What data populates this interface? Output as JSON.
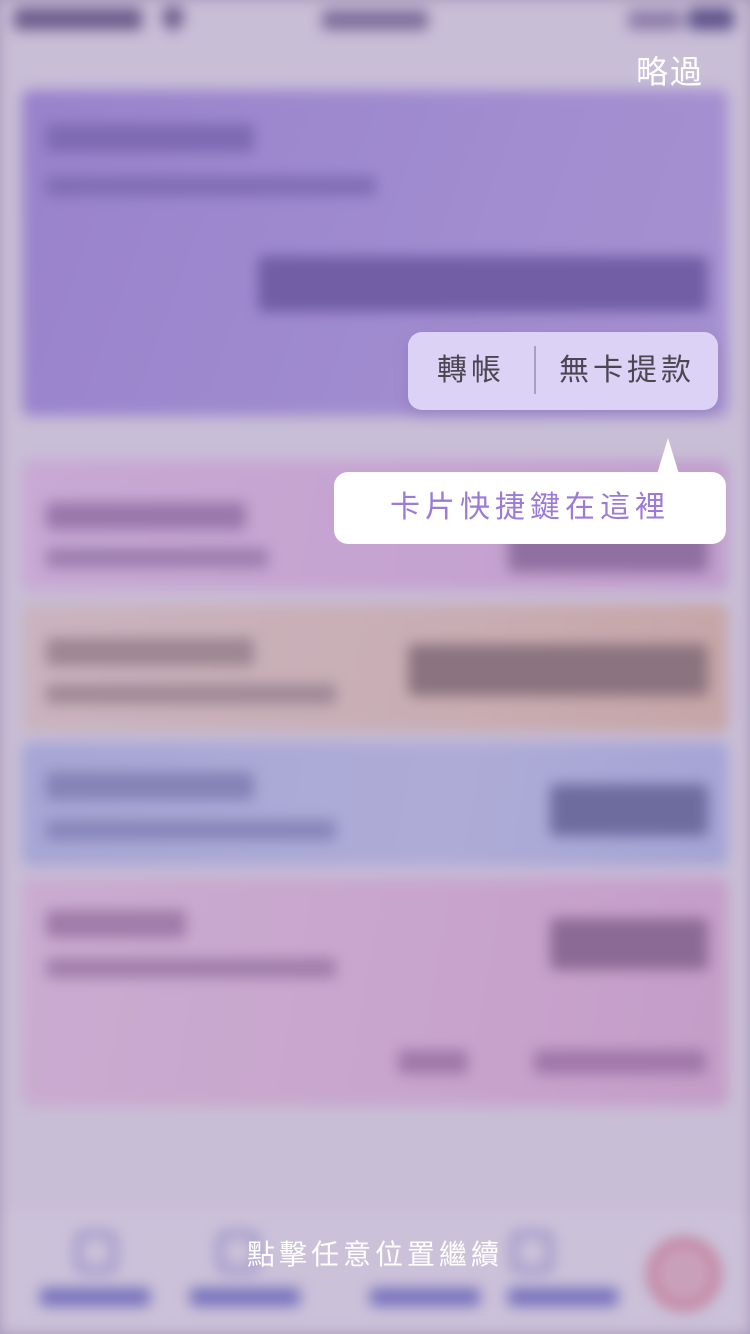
{
  "overlay": {
    "skip_label": "略過",
    "shortcuts": {
      "transfer_label": "轉帳",
      "cardless_withdrawal_label": "無卡提款"
    },
    "tooltip_text": "卡片快捷鍵在這裡",
    "continue_hint": "點擊任意位置繼續"
  },
  "colors": {
    "accent": "#9b7ad8",
    "overlay_tint": "#9682b4",
    "pill_background": "#dcd2f6"
  }
}
